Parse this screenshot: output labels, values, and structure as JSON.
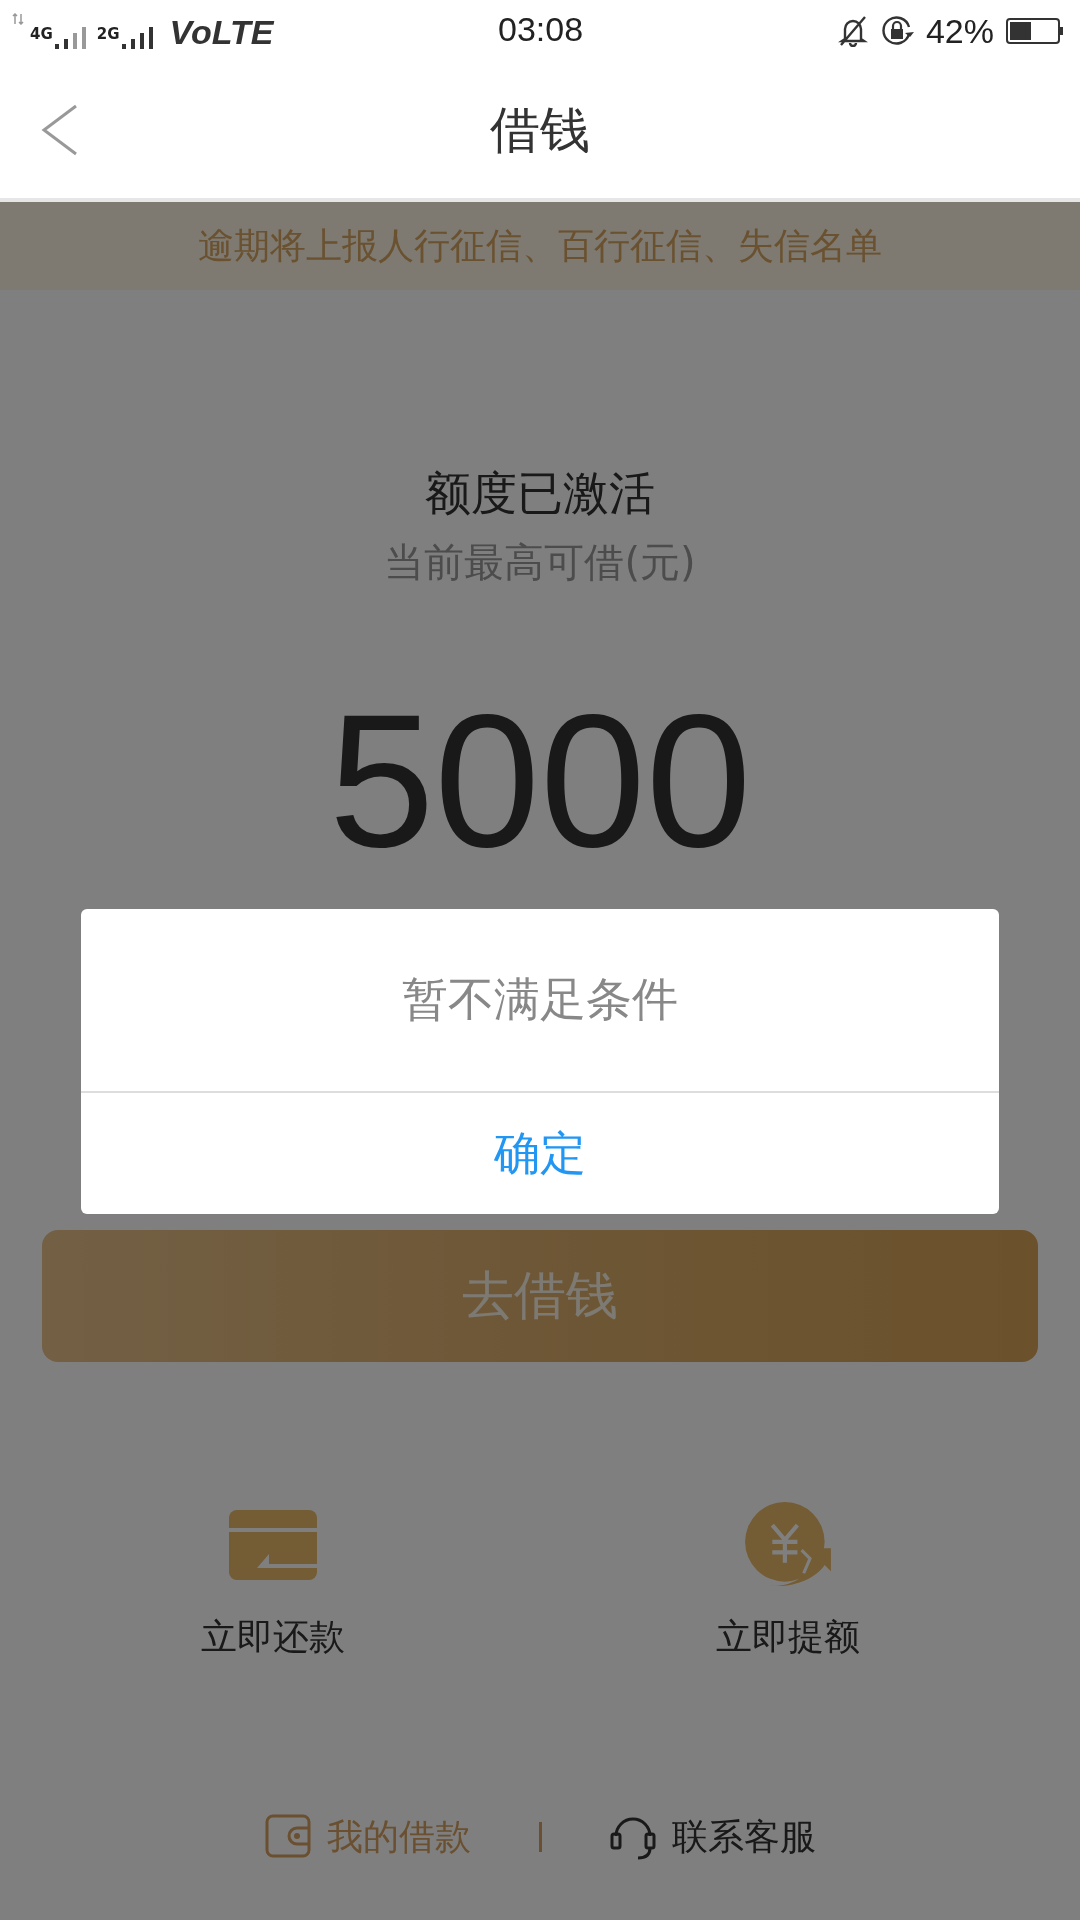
{
  "status_bar": {
    "network_1": "4G",
    "network_2": "2G",
    "volte": "VoLTE",
    "time": "03:08",
    "battery": "42%"
  },
  "header": {
    "title": "借钱"
  },
  "notice": "逾期将上报人行征信、百行征信、失信名单",
  "credit": {
    "status": "额度已激活",
    "subtitle": "当前最高可借(元)",
    "amount": "5000"
  },
  "borrow_button": "去借钱",
  "actions": [
    {
      "kind": "repay",
      "label": "立即还款"
    },
    {
      "kind": "raise",
      "label": "立即提额"
    }
  ],
  "footer_links": [
    {
      "kind": "loans",
      "label": "我的借款"
    },
    {
      "kind": "service",
      "label": "联系客服"
    }
  ],
  "dialog": {
    "message": "暂不满足条件",
    "confirm": "确定"
  }
}
